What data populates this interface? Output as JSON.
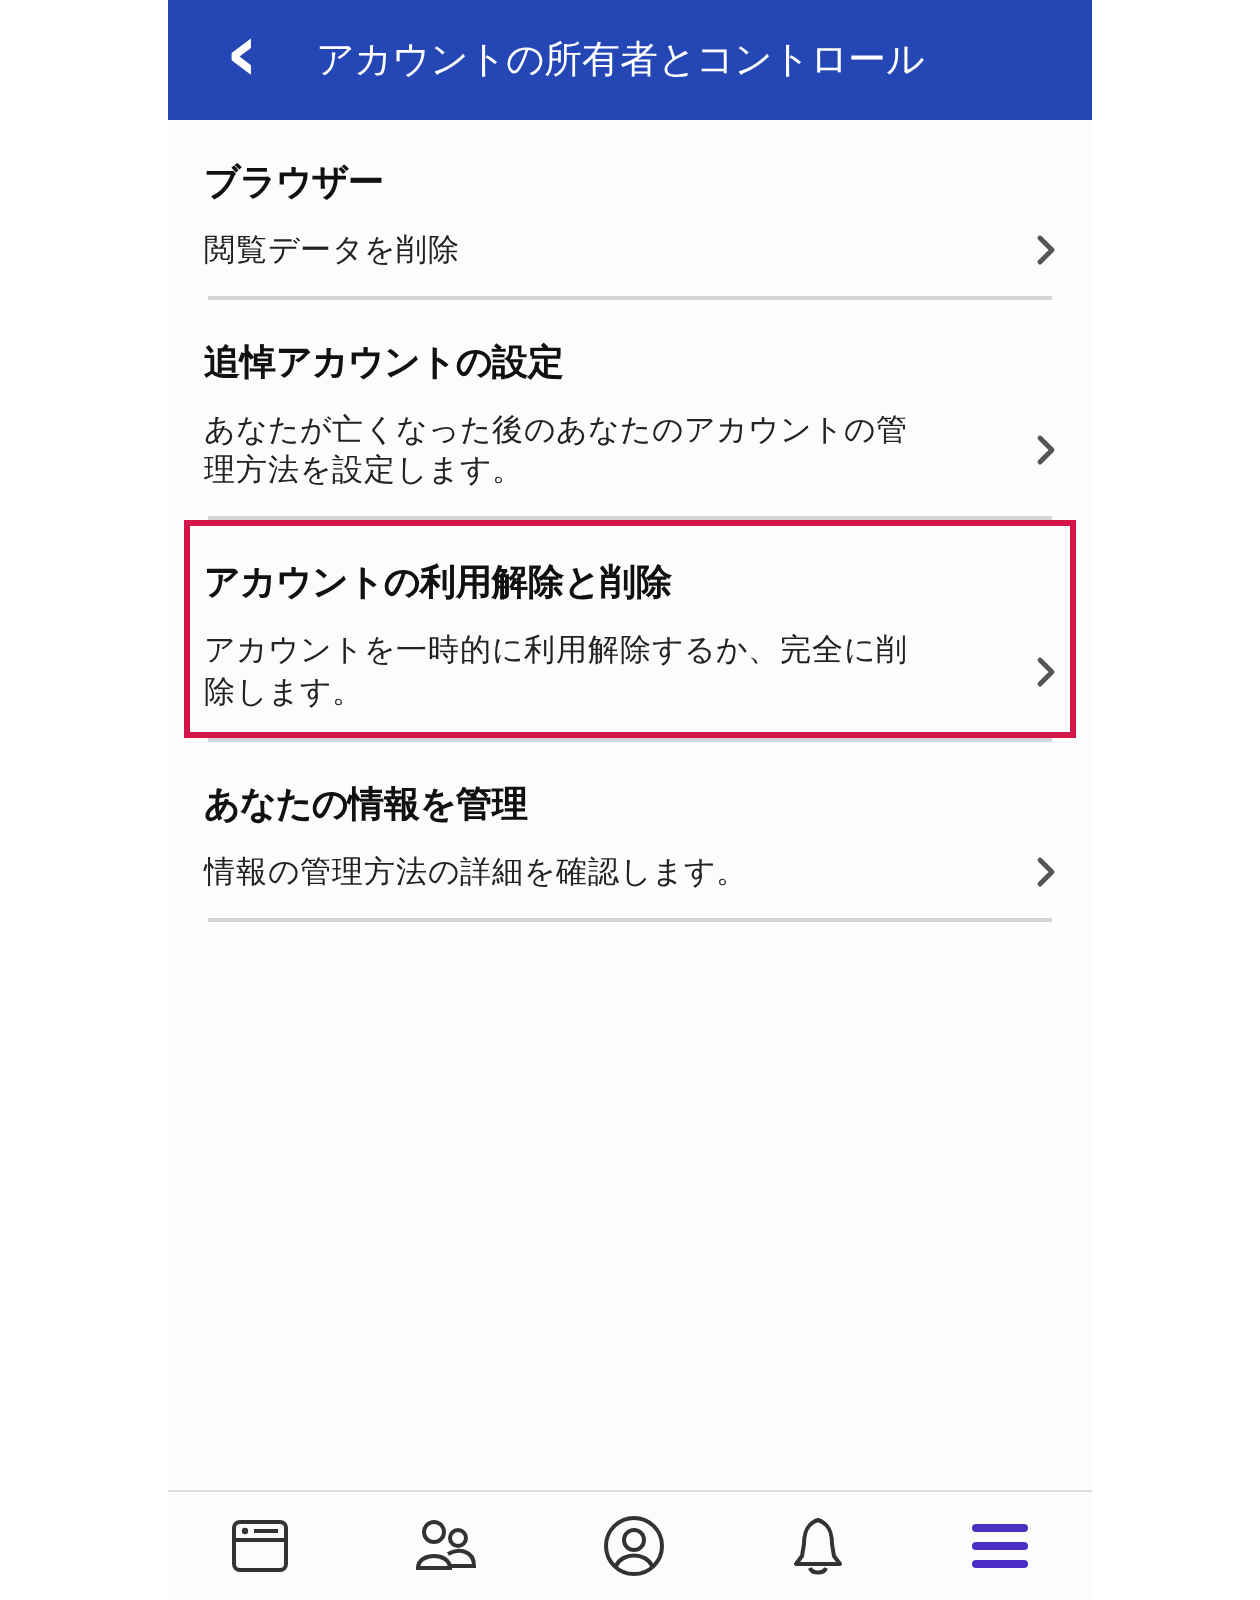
{
  "header": {
    "back": "‹",
    "title": "アカウントの所有者とコントロール"
  },
  "sections": [
    {
      "title": "ブラウザー",
      "description": "閲覧データを削除",
      "highlighted": false
    },
    {
      "title": "追悼アカウントの設定",
      "description": "あなたが亡くなった後のあなたのアカウントの管理方法を設定します。",
      "highlighted": false
    },
    {
      "title": "アカウントの利用解除と削除",
      "description": "アカウントを一時的に利用解除するか、完全に削除します。",
      "highlighted": true
    },
    {
      "title": "あなたの情報を管理",
      "description": "情報の管理方法の詳細を確認します。",
      "highlighted": false
    }
  ],
  "nav": [
    {
      "kind": "feed",
      "selected": false
    },
    {
      "kind": "friends",
      "selected": false
    },
    {
      "kind": "profile",
      "selected": false
    },
    {
      "kind": "bell",
      "selected": false
    },
    {
      "kind": "menu",
      "selected": true
    }
  ]
}
